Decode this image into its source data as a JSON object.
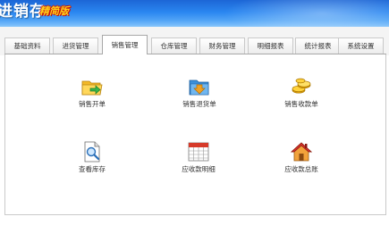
{
  "header": {
    "title": "进销存",
    "edition": "精简版"
  },
  "tabs": [
    {
      "label": "基础资料"
    },
    {
      "label": "进货管理"
    },
    {
      "label": "销售管理"
    },
    {
      "label": "仓库管理"
    },
    {
      "label": "财务管理"
    },
    {
      "label": "明细报表"
    },
    {
      "label": "统计报表"
    },
    {
      "label": "系统设置"
    }
  ],
  "active_tab": "销售管理",
  "modules": [
    {
      "label": "销售开单",
      "icon": "folder-export-icon"
    },
    {
      "label": "销售退货单",
      "icon": "folder-return-icon"
    },
    {
      "label": "销售收款单",
      "icon": "coins-icon"
    },
    {
      "label": "查看库存",
      "icon": "document-search-icon"
    },
    {
      "label": "应收款明细",
      "icon": "calendar-table-icon"
    },
    {
      "label": "应收款总账",
      "icon": "home-icon"
    }
  ],
  "colors": {
    "header_top": "#1c66d6",
    "header_bottom": "#87c5fb",
    "edition_text": "#ffd21a",
    "edition_outline": "#c41010"
  }
}
